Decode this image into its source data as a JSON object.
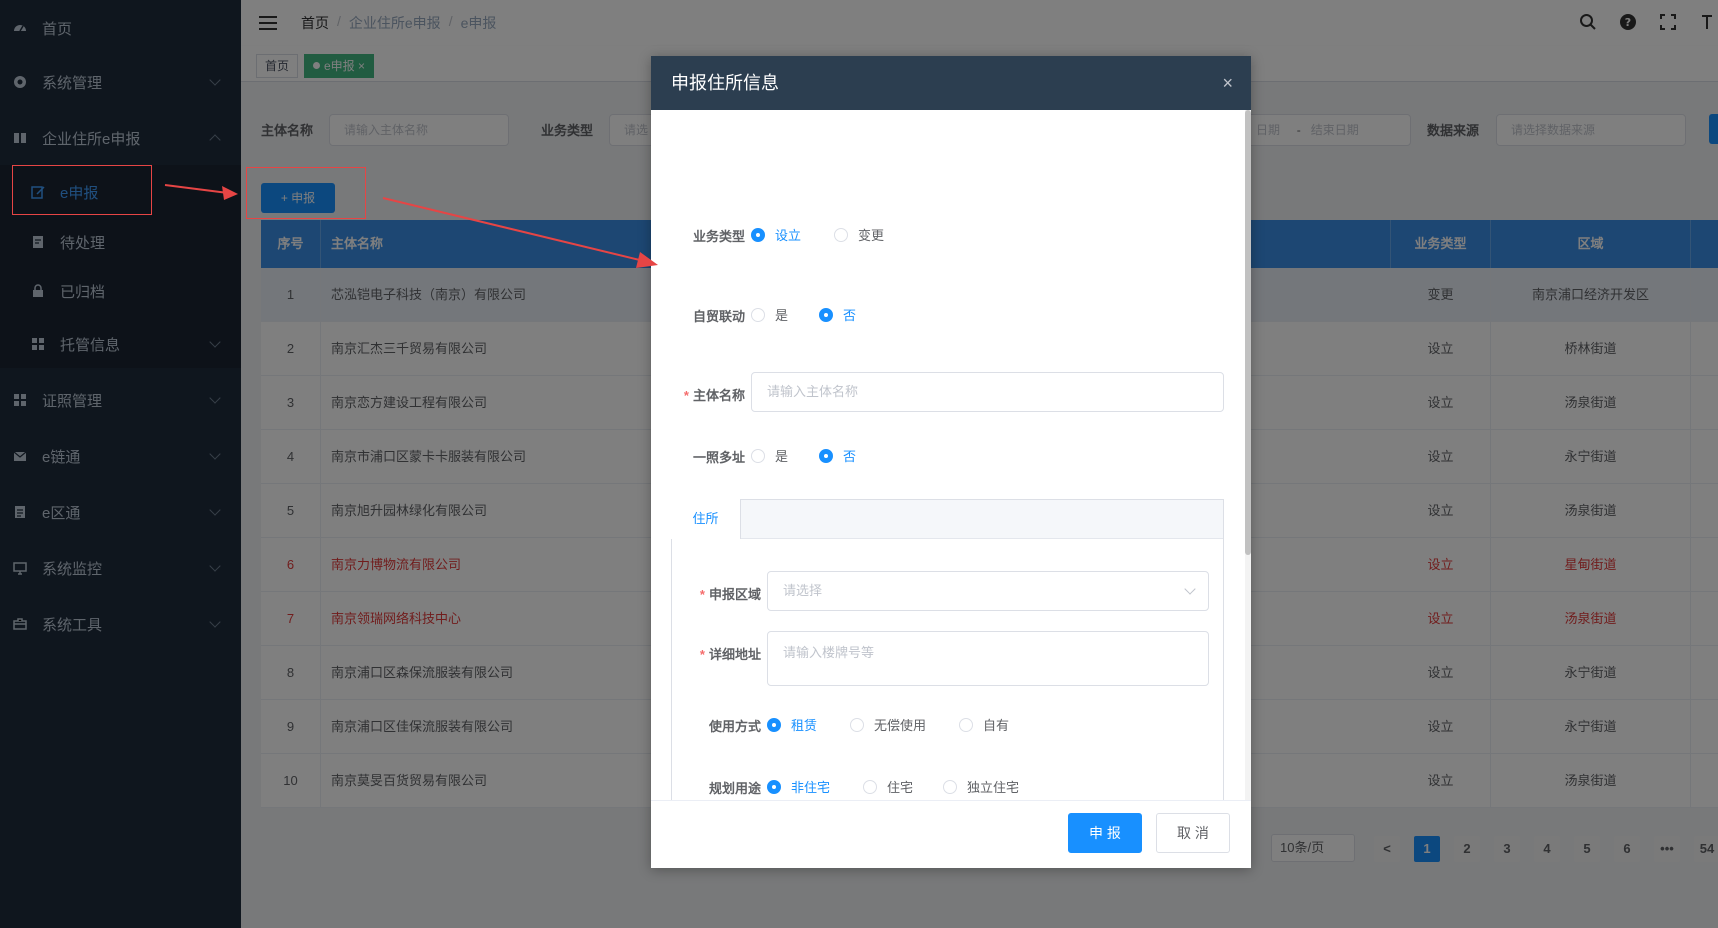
{
  "sidebar": {
    "items": [
      {
        "label": "首页",
        "icon": "dashboard-icon"
      },
      {
        "label": "系统管理",
        "icon": "gear-icon"
      },
      {
        "label": "企业住所e申报",
        "icon": "book-icon"
      },
      {
        "label": "e申报",
        "icon": "edit-icon"
      },
      {
        "label": "待处理",
        "icon": "document-edit-icon"
      },
      {
        "label": "已归档",
        "icon": "lock-icon"
      },
      {
        "label": "托管信息",
        "icon": "grid-icon"
      },
      {
        "label": "证照管理",
        "icon": "grid-icon"
      },
      {
        "label": "e链通",
        "icon": "mail-icon"
      },
      {
        "label": "e区通",
        "icon": "document-icon"
      },
      {
        "label": "系统监控",
        "icon": "monitor-icon"
      },
      {
        "label": "系统工具",
        "icon": "toolbox-icon"
      }
    ]
  },
  "breadcrumb": [
    "首页",
    "企业住所e申报",
    "e申报"
  ],
  "tags": [
    {
      "label": "首页"
    },
    {
      "label": "e申报",
      "close": "×"
    }
  ],
  "filters": {
    "subject_label": "主体名称",
    "subject_placeholder": "请输入主体名称",
    "biztype_label": "业务类型",
    "biztype_placeholder": "请选",
    "date_start": "日期",
    "date_sep": "-",
    "date_end": "结束日期",
    "source_label": "数据来源",
    "source_placeholder": "请选择数据来源"
  },
  "toolbar": {
    "declare_label": "+ 申报"
  },
  "table": {
    "headers": {
      "idx": "序号",
      "name": "主体名称",
      "type": "业务类型",
      "area": "区域"
    },
    "rows": [
      {
        "idx": "1",
        "name": "芯泓铠电子科技（南京）有限公司",
        "type": "变更",
        "area": "南京浦口经济开发区"
      },
      {
        "idx": "2",
        "name": "南京汇杰三千贸易有限公司",
        "type": "设立",
        "area": "桥林街道"
      },
      {
        "idx": "3",
        "name": "南京恋方建设工程有限公司",
        "type": "设立",
        "area": "汤泉街道"
      },
      {
        "idx": "4",
        "name": "南京市浦口区蒙卡卡服装有限公司",
        "type": "设立",
        "area": "永宁街道"
      },
      {
        "idx": "5",
        "name": "南京旭升园林绿化有限公司",
        "type": "设立",
        "area": "汤泉街道"
      },
      {
        "idx": "6",
        "name": "南京力博物流有限公司",
        "type": "设立",
        "area": "星甸街道"
      },
      {
        "idx": "7",
        "name": "南京领瑞网络科技中心",
        "type": "设立",
        "area": "汤泉街道"
      },
      {
        "idx": "8",
        "name": "南京浦口区森保流服装有限公司",
        "type": "设立",
        "area": "永宁街道"
      },
      {
        "idx": "9",
        "name": "南京浦口区佳保流服装有限公司",
        "type": "设立",
        "area": "永宁街道"
      },
      {
        "idx": "10",
        "name": "南京莫旻百货贸易有限公司",
        "type": "设立",
        "area": "汤泉街道"
      }
    ]
  },
  "pagination": {
    "page_size": "10条/页",
    "pages": [
      "1",
      "2",
      "3",
      "4",
      "5",
      "6",
      "•••",
      "54"
    ],
    "prev": "<"
  },
  "dialog": {
    "title": "申报住所信息",
    "close": "×",
    "biz_type": {
      "label": "业务类型",
      "options": [
        "设立",
        "变更"
      ]
    },
    "ftz": {
      "label": "自贸联动",
      "options": [
        "是",
        "否"
      ]
    },
    "subject": {
      "label": "主体名称",
      "placeholder": "请输入主体名称"
    },
    "multi_addr": {
      "label": "一照多址",
      "options": [
        "是",
        "否"
      ]
    },
    "tab_label": "住所",
    "region": {
      "label": "申报区域",
      "placeholder": "请选择"
    },
    "address": {
      "label": "详细地址",
      "placeholder": "请输入楼牌号等"
    },
    "usage": {
      "label": "使用方式",
      "options": [
        "租赁",
        "无偿使用",
        "自有"
      ]
    },
    "planning": {
      "label": "规划用途",
      "options": [
        "非住宅",
        "住宅",
        "独立住宅"
      ]
    },
    "submit": "申 报",
    "cancel": "取 消"
  },
  "colors": {
    "primary": "#1890ff",
    "sidebar": "#1f2d3d",
    "header": "#2c3e50",
    "danger": "#e23b3b",
    "tag": "#42b983"
  }
}
